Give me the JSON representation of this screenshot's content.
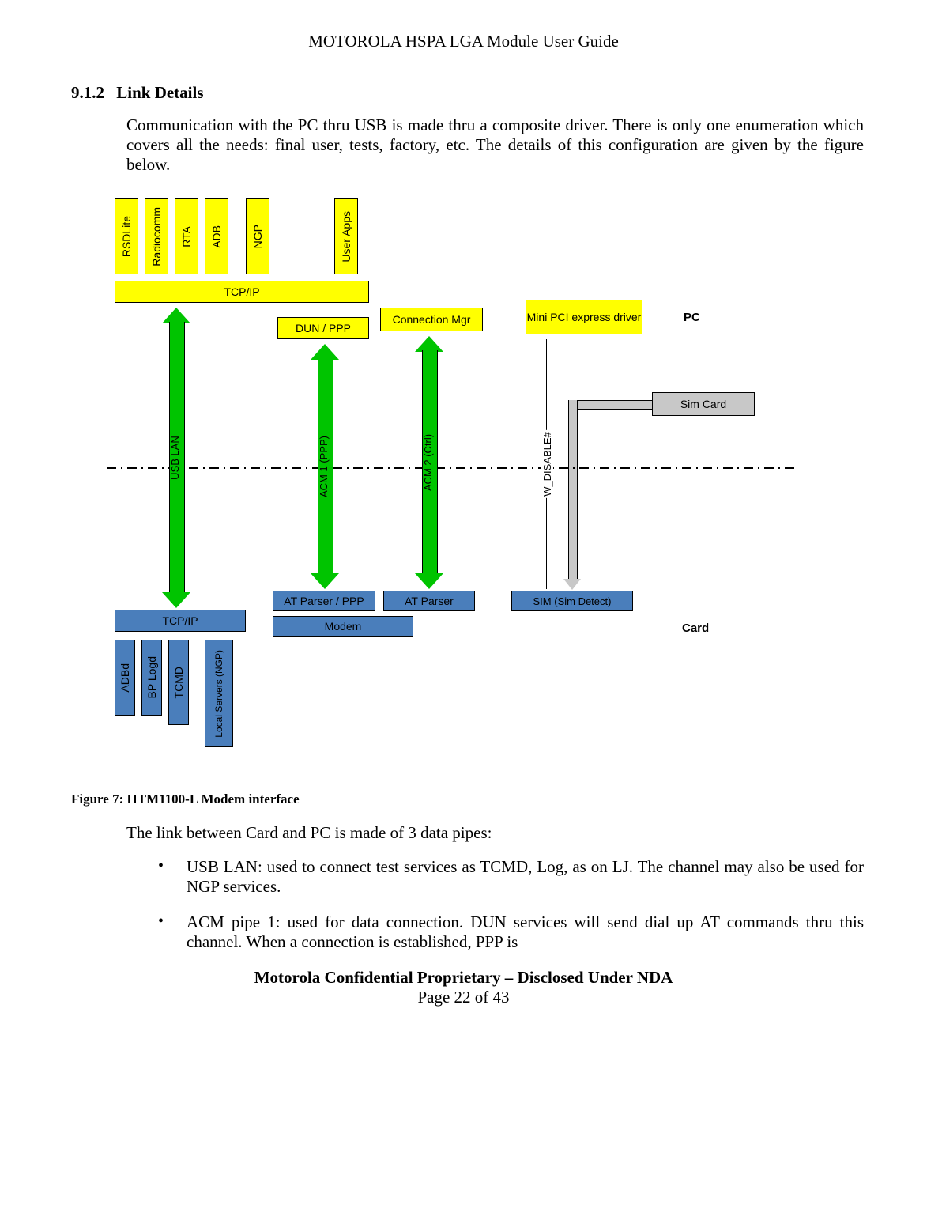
{
  "header": {
    "title": "MOTOROLA HSPA LGA Module User Guide"
  },
  "section": {
    "number": "9.1.2",
    "title": "Link Details"
  },
  "para1": "Communication with the PC thru USB is made thru a composite driver. There is only one enumeration which covers all the needs: final user, tests, factory, etc. The details of this configuration are given by the figure below.",
  "diagram": {
    "top_apps": [
      "RSDLite",
      "Radiocomm",
      "RTA",
      "ADB",
      "NGP",
      "User Apps"
    ],
    "tcpip_top": "TCP/IP",
    "dun_ppp": "DUN / PPP",
    "conn_mgr": "Connection Mgr",
    "mini_pci": "Mini PCI express driver",
    "side_pc": "PC",
    "sim_card": "Sim Card",
    "arrows": {
      "usb_lan": "USB LAN",
      "acm1": "ACM 1 (PPP)",
      "acm2": "ACM 2 (Ctrl)",
      "wdisable": "W_DISABLE#"
    },
    "at_parser_ppp": "AT Parser / PPP",
    "at_parser": "AT Parser",
    "sim_detect": "SIM (Sim Detect)",
    "modem": "Modem",
    "tcpip_bottom": "TCP/IP",
    "bottom_apps": [
      "ADBd",
      "BP Logd",
      "TCMD",
      "Local Servers (NGP)"
    ],
    "side_card": "Card"
  },
  "figure_caption": "Figure 7: HTM1100-L Modem interface",
  "para2": "The link between Card and PC is made of 3 data pipes:",
  "bullets": [
    "USB LAN: used to connect test services as TCMD, Log, as on LJ. The channel may also be used for NGP services.",
    "ACM pipe 1: used for data connection. DUN services will send dial up AT commands thru this channel. When a connection is established, PPP is"
  ],
  "footer": {
    "line1": "Motorola Confidential Proprietary – Disclosed Under NDA",
    "line2": "Page 22 of 43"
  }
}
